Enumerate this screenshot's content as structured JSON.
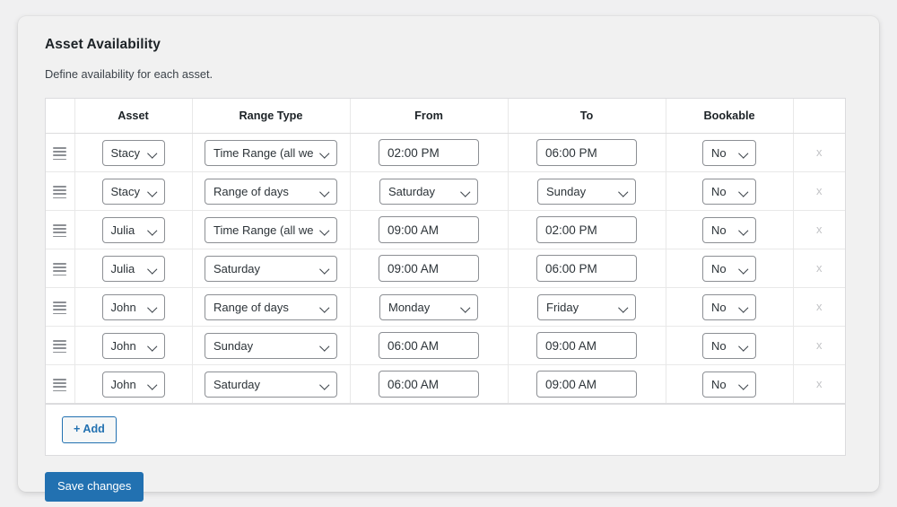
{
  "card": {
    "title": "Asset Availability",
    "subtitle": "Define availability for each asset."
  },
  "table": {
    "columns": [
      "",
      "Asset",
      "Range Type",
      "From",
      "To",
      "Bookable",
      ""
    ],
    "headers": {
      "handle": "",
      "asset": "Asset",
      "range_type": "Range Type",
      "from": "From",
      "to": "To",
      "bookable": "Bookable",
      "delete": ""
    },
    "rows": [
      {
        "handle_icon": "drag-handle-icon",
        "asset": "Stacy",
        "range_type": "Time Range (all we",
        "from_type": "text",
        "from": "02:00 PM",
        "to_type": "text",
        "to": "06:00 PM",
        "bookable": "No",
        "delete_label": "x"
      },
      {
        "handle_icon": "drag-handle-icon",
        "asset": "Stacy",
        "range_type": "Range of days",
        "from_type": "select",
        "from": "Saturday",
        "to_type": "select",
        "to": "Sunday",
        "bookable": "No",
        "delete_label": "x"
      },
      {
        "handle_icon": "drag-handle-icon",
        "asset": "Julia",
        "range_type": "Time Range (all we",
        "from_type": "text",
        "from": "09:00 AM",
        "to_type": "text",
        "to": "02:00 PM",
        "bookable": "No",
        "delete_label": "x"
      },
      {
        "handle_icon": "drag-handle-icon",
        "asset": "Julia",
        "range_type": "Saturday",
        "from_type": "text",
        "from": "09:00 AM",
        "to_type": "text",
        "to": "06:00 PM",
        "bookable": "No",
        "delete_label": "x"
      },
      {
        "handle_icon": "drag-handle-icon",
        "asset": "John",
        "range_type": "Range of days",
        "from_type": "select",
        "from": "Monday",
        "to_type": "select",
        "to": "Friday",
        "bookable": "No",
        "delete_label": "x"
      },
      {
        "handle_icon": "drag-handle-icon",
        "asset": "John",
        "range_type": "Sunday",
        "from_type": "text",
        "from": "06:00 AM",
        "to_type": "text",
        "to": "09:00 AM",
        "bookable": "No",
        "delete_label": "x"
      },
      {
        "handle_icon": "drag-handle-icon",
        "asset": "John",
        "range_type": "Saturday",
        "from_type": "text",
        "from": "06:00 AM",
        "to_type": "text",
        "to": "09:00 AM",
        "bookable": "No",
        "delete_label": "x"
      }
    ],
    "add_button": "+ Add"
  },
  "actions": {
    "save_button": "Save changes"
  },
  "colors": {
    "accent": "#2271b1",
    "page_bg": "#f0f0f1",
    "card_bg": "#f1f1f1",
    "table_bg": "#ffffff",
    "border": "#dcdcde",
    "text": "#1d2327",
    "muted": "#3c434a",
    "delete_x": "#c3c4c7"
  }
}
